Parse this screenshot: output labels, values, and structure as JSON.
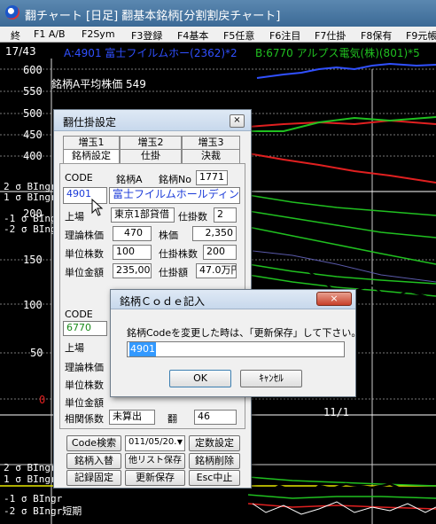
{
  "window": {
    "title": "翻チャート [日足] 翻基本銘柄[分割割戻チャート]"
  },
  "menu": [
    "終",
    "F1 A/B",
    "F2Sym",
    "F3登録",
    "F4基本",
    "F5任意",
    "F6注目",
    "F7仕掛",
    "F8保有",
    "F9元帳"
  ],
  "chart": {
    "counter": "17/43",
    "stock_a": "A:4901 富士フイルムホー(2362)*2",
    "stock_b": "B:6770 アルプス電気(株)(801)*5",
    "avg_label": "銘柄A平均株価 549",
    "upper_axis": [
      "600",
      "550",
      "500",
      "450",
      "400"
    ],
    "mid_axis": [
      "200",
      "150",
      "100",
      "50",
      "0"
    ],
    "band_labels_top": [
      "2 σ BIngr",
      "1 σ BIngr",
      "-1 σ BIngr",
      "-2 σ BIngr"
    ],
    "band_labels_bottom": [
      "2 σ BIngr",
      "1 σ BIngr",
      "-1 σ BIngr",
      "-2 σ BIngr短期"
    ],
    "date_label": "11/1",
    "colors": {
      "red": "#e02020",
      "green": "#20c020",
      "blue": "#3050ff",
      "yellow": "#e8e800"
    }
  },
  "settings_dialog": {
    "title": "翻仕掛設定",
    "close": "×",
    "tabs_row1": [
      "増玉1",
      "増玉2",
      "増玉3"
    ],
    "tabs_row2": [
      "銘柄設定",
      "仕掛",
      "決裁"
    ],
    "code_label": "CODE",
    "meigara_a_label": "銘柄A",
    "meigara_no_label": "銘柄No",
    "meigara_no": "1771",
    "code_a": "4901",
    "name_a": "富士フイルムホールディン",
    "market_label": "上場",
    "market": "東京1部貸借",
    "shikake_count_label": "仕掛数",
    "shikake_count": "2",
    "theory_price_label": "理論株価",
    "theory_price": "470",
    "price_label": "株価",
    "price": "2,350",
    "unit_shares_label": "単位株数",
    "unit_shares": "100",
    "shikake_shares_label": "仕掛株数",
    "shikake_shares": "200",
    "unit_amount_label": "単位金額",
    "unit_amount": "235,000",
    "shikake_amount_label": "仕掛額",
    "shikake_amount": "47.0万円",
    "code_label_b": "CODE",
    "code_b": "6770",
    "market_label_b": "上場",
    "theory_price_label_b": "理論株価",
    "unit_shares_label_b": "単位株数",
    "unit_amount_label_b": "単位金額",
    "correlation_label": "相関係数",
    "correlation_value": "未算出",
    "hane_label": "翻",
    "hane_value": "46",
    "buttons": {
      "code_search": "Code検索",
      "date_select": "011/05/20.",
      "fixed_setting": "定数設定",
      "swap": "銘柄入替",
      "other_list_save": "他リスト保存",
      "delete": "銘柄削除",
      "record_fix": "記録固定",
      "update_save": "更新保存",
      "esc": "Esc中止"
    }
  },
  "code_dialog": {
    "title": "銘柄Ｃｏｄｅ記入",
    "close": "×",
    "message": "銘柄Codeを変更した時は、「更新保存」して下さい。",
    "input_value": "4901",
    "ok": "OK",
    "cancel": "ｷｬﾝｾﾙ"
  }
}
